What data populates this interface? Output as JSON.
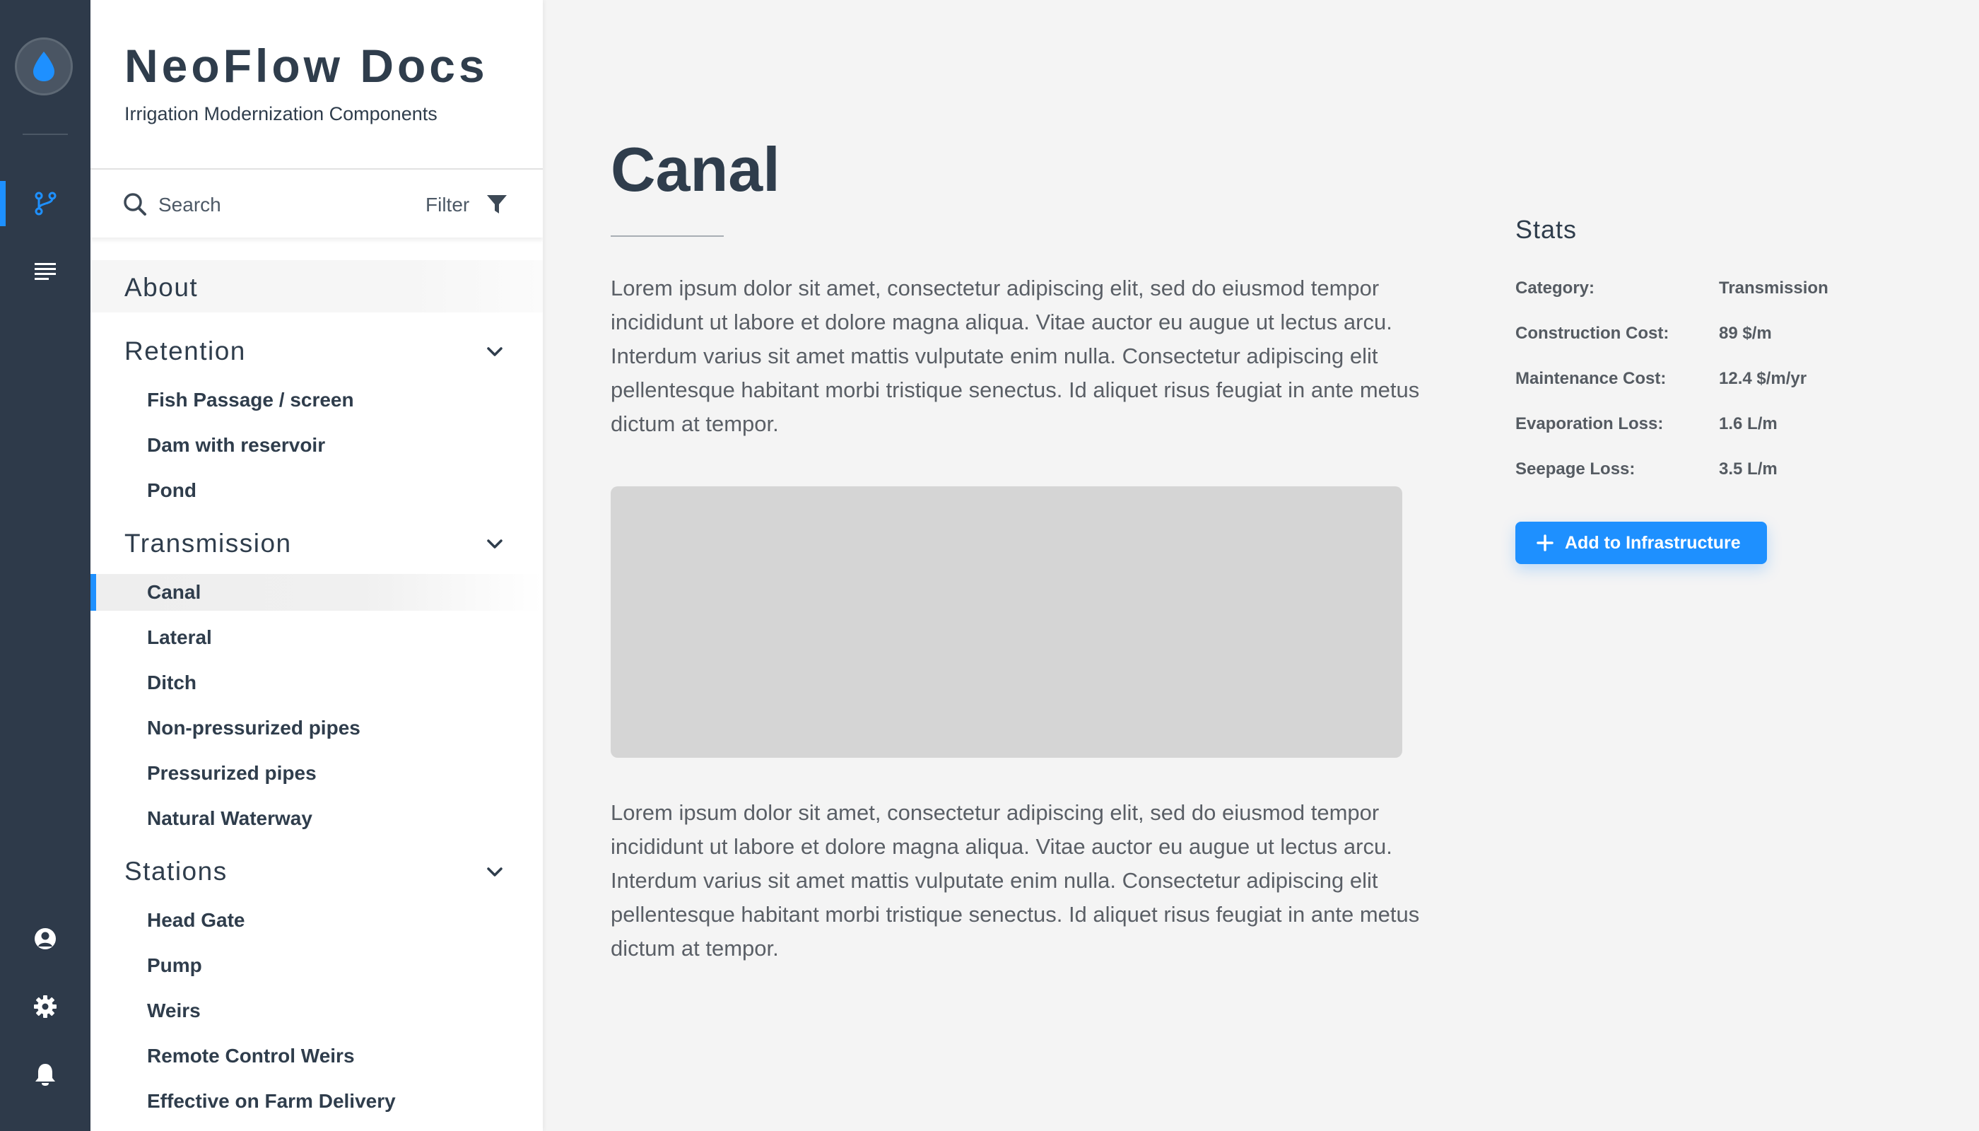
{
  "brand": {
    "title": "NeoFlow Docs",
    "subtitle": "Irrigation Modernization Components"
  },
  "rail": {
    "icons": [
      "water-drop-icon",
      "branch-icon",
      "list-icon",
      "user-icon",
      "gear-icon",
      "bell-icon"
    ],
    "active": "branch-icon"
  },
  "search": {
    "label": "Search",
    "filter_label": "Filter"
  },
  "nav": {
    "about": "About",
    "groups": [
      {
        "title": "Retention",
        "items": [
          "Fish Passage / screen",
          "Dam with reservoir",
          "Pond"
        ]
      },
      {
        "title": "Transmission",
        "items": [
          "Canal",
          "Lateral",
          "Ditch",
          "Non-pressurized pipes",
          "Pressurized pipes",
          "Natural Waterway"
        ]
      },
      {
        "title": "Stations",
        "items": [
          "Head Gate",
          "Pump",
          "Weirs",
          "Remote Control Weirs",
          "Effective on Farm Delivery"
        ]
      }
    ],
    "active_item": "Canal"
  },
  "content": {
    "title": "Canal",
    "paragraph_1": "Lorem ipsum dolor sit amet, consectetur adipiscing elit, sed do eiusmod tempor incididunt ut labore et dolore magna aliqua. Vitae auctor eu augue ut lectus arcu. Interdum varius sit amet mattis vulputate enim nulla. Consectetur adipiscing elit pellentesque habitant morbi tristique senectus. Id aliquet risus feugiat in ante metus dictum at tempor.",
    "paragraph_2": "Lorem ipsum dolor sit amet, consectetur adipiscing elit, sed do eiusmod tempor incididunt ut labore et dolore magna aliqua. Vitae auctor eu augue ut lectus arcu. Interdum varius sit amet mattis vulputate enim nulla. Consectetur adipiscing elit pellentesque habitant morbi tristique senectus. Id aliquet risus feugiat in ante metus dictum at tempor."
  },
  "stats": {
    "title": "Stats",
    "rows": [
      {
        "label": "Category:",
        "value": "Transmission"
      },
      {
        "label": "Construction Cost:",
        "value": "89 $/m"
      },
      {
        "label": "Maintenance Cost:",
        "value": "12.4 $/m/yr"
      },
      {
        "label": "Evaporation Loss:",
        "value": "1.6 L/m"
      },
      {
        "label": "Seepage Loss:",
        "value": "3.5 L/m"
      }
    ],
    "button_label": "Add to Infrastructure"
  },
  "colors": {
    "accent": "#1e90ff",
    "rail_bg": "#2e3a4a",
    "text_dark": "#2f3d4c"
  }
}
